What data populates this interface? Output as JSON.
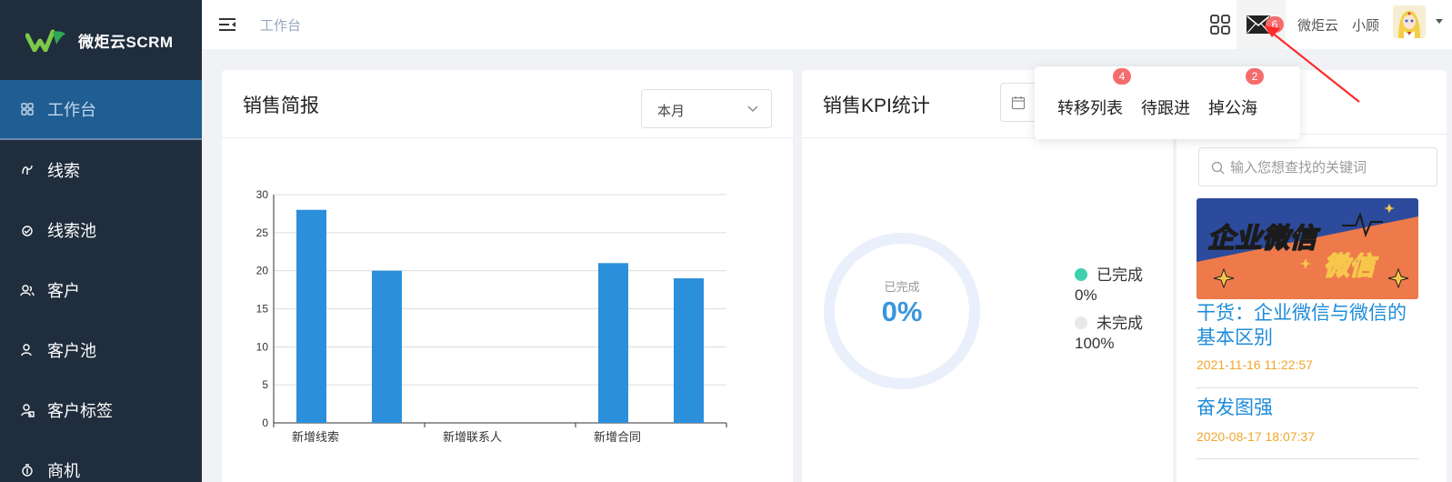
{
  "app": {
    "brand": "微炬云SCRM"
  },
  "sidebar": {
    "items": [
      {
        "label": "工作台",
        "icon": "grid-icon",
        "active": true
      },
      {
        "label": "线索",
        "icon": "lead-icon"
      },
      {
        "label": "线索池",
        "icon": "lead-pool-icon"
      },
      {
        "label": "客户",
        "icon": "customer-icon"
      },
      {
        "label": "客户池",
        "icon": "customer-pool-icon"
      },
      {
        "label": "客户标签",
        "icon": "customer-tag-icon"
      },
      {
        "label": "商机",
        "icon": "opportunity-icon"
      }
    ]
  },
  "header": {
    "breadcrumb": "工作台",
    "mail_badge": "6",
    "org_name": "微炬云",
    "user_name": "小顾"
  },
  "popover": {
    "items": [
      {
        "label": "转移列表",
        "badge": "4"
      },
      {
        "label": "待跟进",
        "badge": ""
      },
      {
        "label": "掉公海",
        "badge": "2"
      }
    ]
  },
  "sales_report": {
    "title": "销售简报",
    "period_select": "本月"
  },
  "chart_data": {
    "type": "bar",
    "categories": [
      "新增线索",
      "新增联系人",
      "新增合同"
    ],
    "series": [
      {
        "values": [
          28,
          0,
          21
        ]
      },
      {
        "values": [
          20,
          0,
          19
        ]
      }
    ],
    "ylim": [
      0,
      30
    ],
    "yticks": [
      "0",
      "5",
      "10",
      "15",
      "20",
      "25",
      "30"
    ],
    "grid": true,
    "color": "#2b8fdb"
  },
  "kpi": {
    "title": "销售KPI统计",
    "ring_label": "已完成",
    "ring_value": "0%",
    "legend": [
      {
        "label": "已完成",
        "value": "0%",
        "color": "#3fd0b0"
      },
      {
        "label": "未完成",
        "value": "100%",
        "color": "#e8e8e8"
      }
    ]
  },
  "news": {
    "search_placeholder": "输入您想查找的关键词",
    "banner_text_1": "企业微信",
    "banner_text_2": "微信",
    "articles": [
      {
        "title": "干货：企业微信与微信的基本区别",
        "date": "2021-11-16 11:22:57"
      },
      {
        "title": "奋发图强",
        "date": "2020-08-17 18:07:37"
      }
    ]
  }
}
